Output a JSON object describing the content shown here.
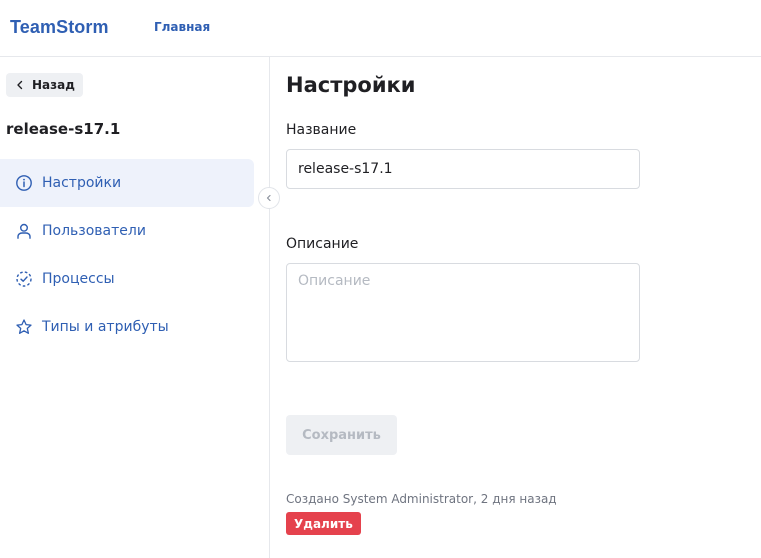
{
  "header": {
    "logo": "TeamStorm",
    "nav_home": "Главная"
  },
  "sidebar": {
    "back_label": "Назад",
    "project_name": "release-s17.1",
    "items": [
      {
        "label": "Настройки",
        "icon": "info-icon",
        "active": true
      },
      {
        "label": "Пользователи",
        "icon": "user-icon",
        "active": false
      },
      {
        "label": "Процессы",
        "icon": "process-icon",
        "active": false
      },
      {
        "label": "Типы и атрибуты",
        "icon": "star-icon",
        "active": false
      }
    ]
  },
  "main": {
    "title": "Настройки",
    "name_label": "Название",
    "name_value": "release-s17.1",
    "description_label": "Описание",
    "description_placeholder": "Описание",
    "description_value": "",
    "save_label": "Сохранить",
    "created_text": "Создано System Administrator, 2 дня назад",
    "delete_label": "Удалить"
  },
  "colors": {
    "brand": "#2f5fb3",
    "active_bg": "#eef2fb",
    "danger": "#e5424d",
    "disabled_bg": "#eef0f3",
    "disabled_text": "#b5bac2"
  }
}
